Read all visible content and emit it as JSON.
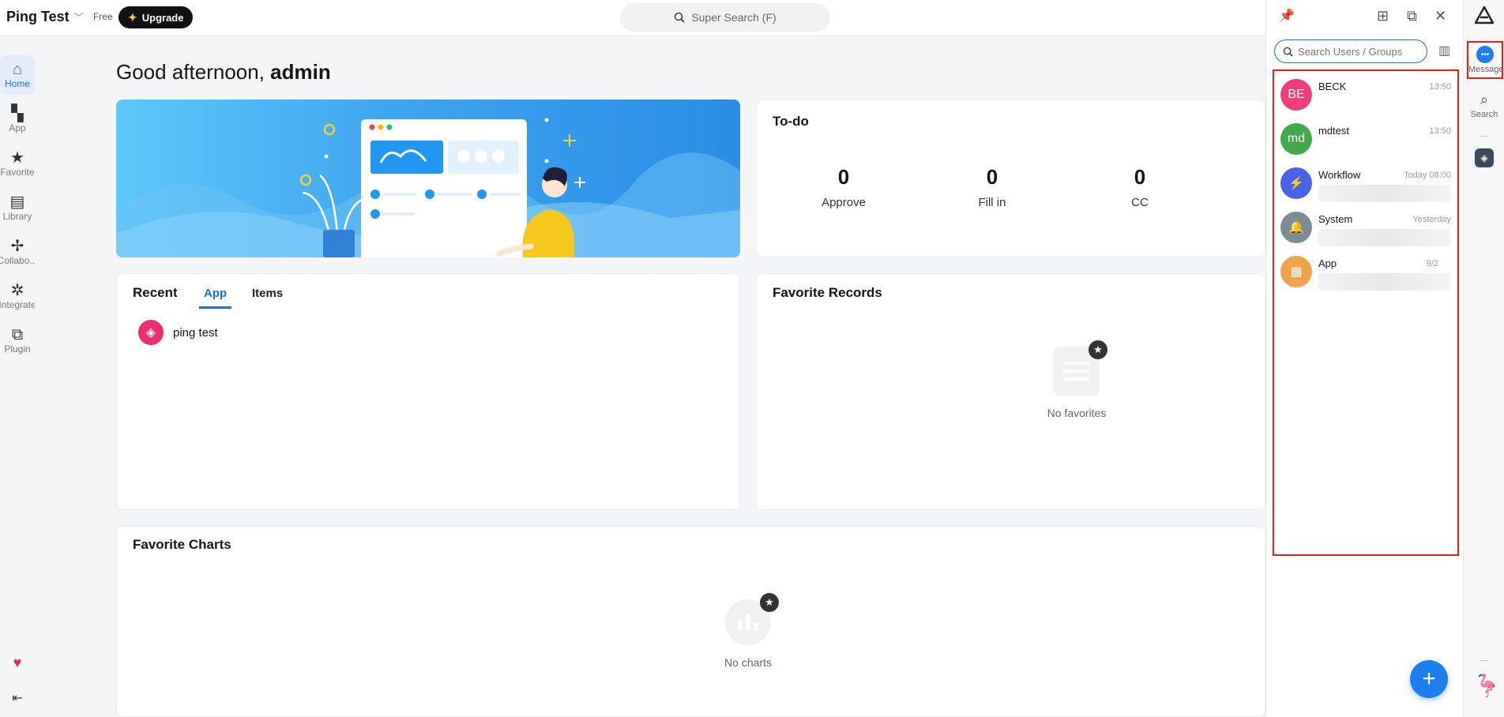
{
  "header": {
    "workspace": "Ping Test",
    "plan": "Free",
    "upgrade_label": "Upgrade",
    "search_label": "Super Search (F)"
  },
  "nav": {
    "items": [
      {
        "label": "Home",
        "icon": "home-icon"
      },
      {
        "label": "App",
        "icon": "grid-icon"
      },
      {
        "label": "Favorite",
        "icon": "star-icon"
      },
      {
        "label": "Library",
        "icon": "store-icon"
      },
      {
        "label": "Collabo...",
        "icon": "pinwheel-icon"
      },
      {
        "label": "Integrate",
        "icon": "hub-icon"
      },
      {
        "label": "Plugin",
        "icon": "puzzle-icon"
      }
    ]
  },
  "greeting": {
    "prefix": "Good afternoon,",
    "user": "admin"
  },
  "todo": {
    "title": "To-do",
    "stats": [
      {
        "value": "0",
        "label": "Approve"
      },
      {
        "value": "0",
        "label": "Fill in"
      },
      {
        "value": "0",
        "label": "CC"
      }
    ]
  },
  "recent": {
    "title": "Recent",
    "tabs": [
      "App",
      "Items"
    ],
    "items": [
      {
        "name": "ping test"
      }
    ]
  },
  "favorite_records": {
    "title": "Favorite Records",
    "empty_text": "No favorites"
  },
  "favorite_charts": {
    "title": "Favorite Charts",
    "empty_text": "No charts"
  },
  "messages": {
    "search_placeholder": "Search Users / Groups",
    "list": [
      {
        "name": "BECK",
        "initials": "BE",
        "time": "13:50",
        "color": "#ee3f7a"
      },
      {
        "name": "mdtest",
        "initials": "md",
        "time": "13:50",
        "color": "#43a84a"
      },
      {
        "name": "Workflow",
        "initials": "⚡",
        "time": "Today 08:00",
        "color": "#4a63e6"
      },
      {
        "name": "System",
        "initials": "🔔",
        "time": "Yesterday",
        "color": "#7b8c97"
      },
      {
        "name": "App",
        "initials": "▦",
        "time": "9/2",
        "color": "#f2a24a"
      }
    ]
  },
  "rail": {
    "message_label": "Message",
    "search_label": "Search"
  },
  "colors": {
    "accent": "#1e6fd9",
    "highlight": "#e0201b"
  }
}
